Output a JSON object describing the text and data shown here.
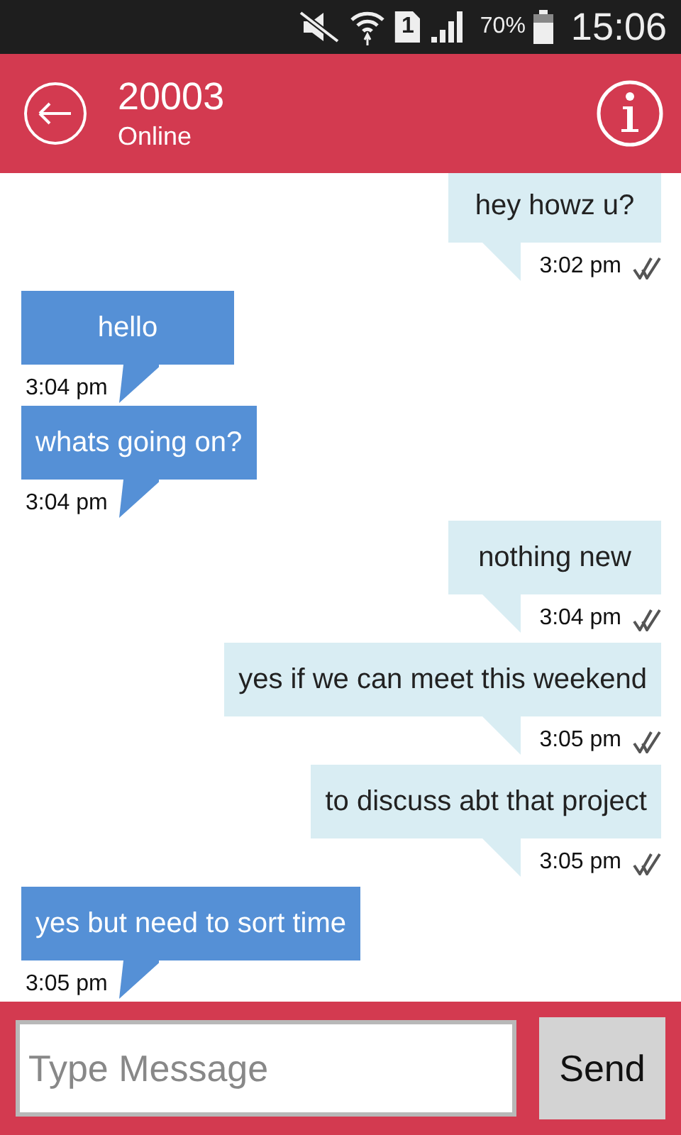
{
  "status_bar": {
    "sim_slot": "1",
    "battery": "70%",
    "time": "15:06"
  },
  "header": {
    "title": "20003",
    "status": "Online"
  },
  "messages": [
    {
      "kind": "sent",
      "text": "hey howz u?",
      "time": "3:02 pm"
    },
    {
      "kind": "received",
      "text": "hello",
      "time": "3:04 pm"
    },
    {
      "kind": "received",
      "text": "whats going on?",
      "time": "3:04 pm"
    },
    {
      "kind": "sent",
      "text": "nothing new",
      "time": "3:04 pm"
    },
    {
      "kind": "sent",
      "text": "yes if we can meet this weekend",
      "time": "3:05 pm"
    },
    {
      "kind": "sent",
      "text": "to discuss abt that project",
      "time": "3:05 pm"
    },
    {
      "kind": "received",
      "text": "yes but need to sort time",
      "time": "3:05 pm"
    }
  ],
  "composer": {
    "placeholder": "Type Message",
    "send": "Send"
  }
}
